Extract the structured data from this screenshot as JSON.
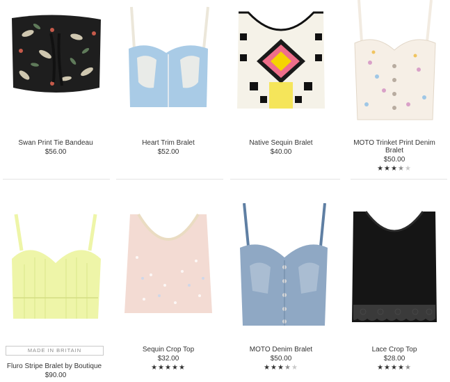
{
  "products": [
    {
      "name": "Swan Print Tie Bandeau",
      "price": "$56.00",
      "rating": null
    },
    {
      "name": "Heart Trim Bralet",
      "price": "$52.00",
      "rating": null
    },
    {
      "name": "Native Sequin Bralet",
      "price": "$40.00",
      "rating": null
    },
    {
      "name": "MOTO Trinket Print Denim",
      "name_line2": "Bralet",
      "price": "$50.00",
      "rating": 3.5
    },
    {
      "name": "Fluro Stripe Bralet by Boutique",
      "price": "$90.00",
      "rating": null,
      "badge": "MADE IN BRITAIN"
    },
    {
      "name": "Sequin Crop Top",
      "price": "$32.00",
      "rating": 5
    },
    {
      "name": "MOTO Denim Bralet",
      "price": "$50.00",
      "rating": 3.5
    },
    {
      "name": "Lace Crop Top",
      "price": "$28.00",
      "rating": 4.5
    }
  ],
  "colors": {
    "swan": "#1e1e1e",
    "heart": "#a9cbe6",
    "native": "#f5f2e8",
    "trinket": "#f6efe6",
    "fluro": "#eef5a8",
    "sequin": "#f3dbd3",
    "denim": "#8fa8c4",
    "lace": "#151515"
  }
}
